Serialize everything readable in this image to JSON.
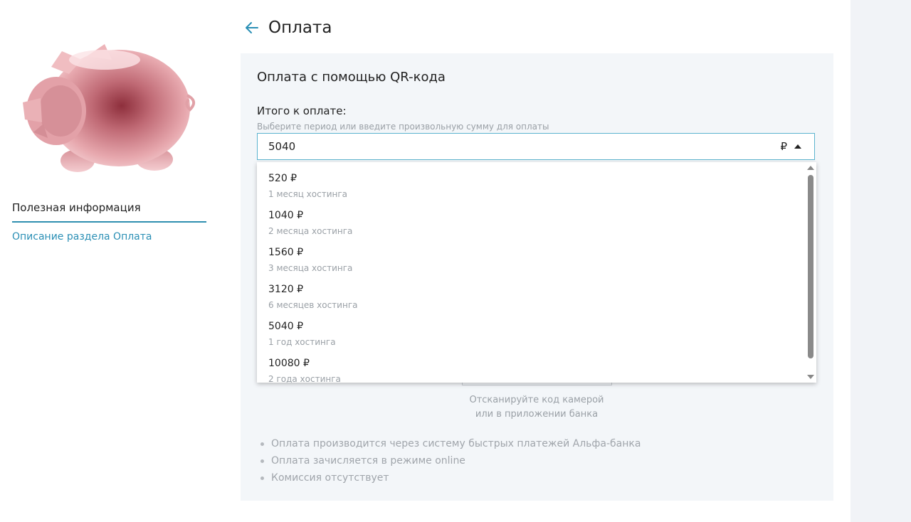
{
  "header": {
    "title": "Оплата"
  },
  "sidebar": {
    "section_title": "Полезная информация",
    "link": "Описание раздела Оплата"
  },
  "payment": {
    "card_title": "Оплата с помощью QR-кода",
    "amount_label": "Итого к оплате:",
    "amount_hint": "Выберите период или введите произвольную сумму для оплаты",
    "amount_value": "5040",
    "currency": "₽",
    "options": [
      {
        "price": "520 ₽",
        "period": "1 месяц хостинга"
      },
      {
        "price": "1040 ₽",
        "period": "2 месяца хостинга"
      },
      {
        "price": "1560 ₽",
        "period": "3 месяца хостинга"
      },
      {
        "price": "3120 ₽",
        "period": "6 месяцев хостинга"
      },
      {
        "price": "5040 ₽",
        "period": "1 год хостинга"
      },
      {
        "price": "10080 ₽",
        "period": "2 года хостинга"
      }
    ],
    "qr_caption_line1": "Отсканируйте код камерой",
    "qr_caption_line2": "или в приложении банка",
    "notes": [
      "Оплата производится через систему быстрых платежей Альфа-банка",
      "Оплата зачисляется в режиме online",
      "Комиссия отсутствует"
    ]
  },
  "colors": {
    "accent": "#2a8fb5",
    "input_border": "#5bb3cf",
    "card_bg": "#f3f6f9",
    "muted_text": "#9aa0a6",
    "piggy": "#e8a7ad"
  }
}
